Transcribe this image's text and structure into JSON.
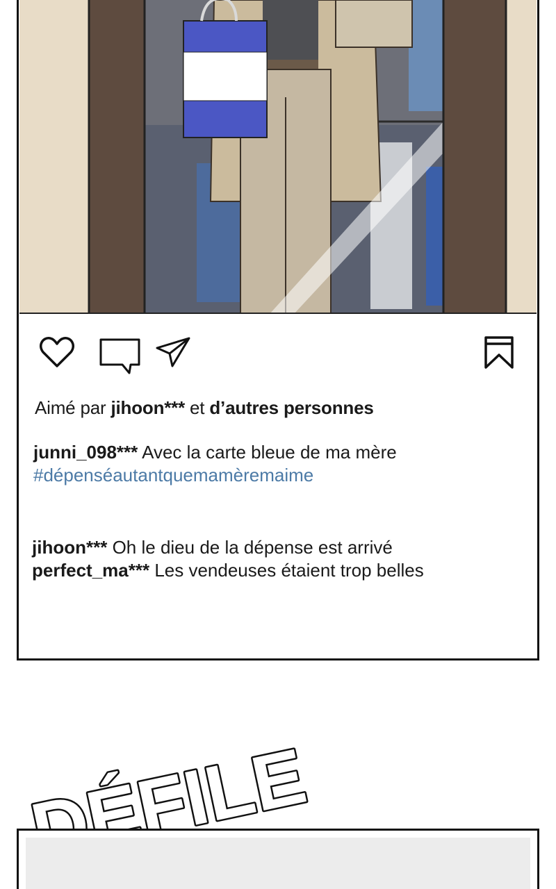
{
  "post": {
    "likes": {
      "prefix": "Aimé par",
      "user": "jihoon***",
      "joiner": "et",
      "others": "d’autres personnes"
    },
    "caption": {
      "username": "junni_098***",
      "text": "Avec la carte bleue de ma mère",
      "hashtag": "#dépenséautantquemamèremaime"
    },
    "comments": [
      {
        "username": "jihoon***",
        "text": "Oh le dieu de la dépense est arrivé"
      },
      {
        "username": "perfect_ma***",
        "text": "Les vendeuses étaient trop belles"
      }
    ],
    "icons": [
      "heart-icon",
      "comment-icon",
      "share-icon",
      "bookmark-icon"
    ]
  },
  "scroll_prompt": "DÉFILE",
  "colors": {
    "hashtag": "#4c7aa6",
    "border": "#111111",
    "bag_blue": "#4b57c4"
  }
}
